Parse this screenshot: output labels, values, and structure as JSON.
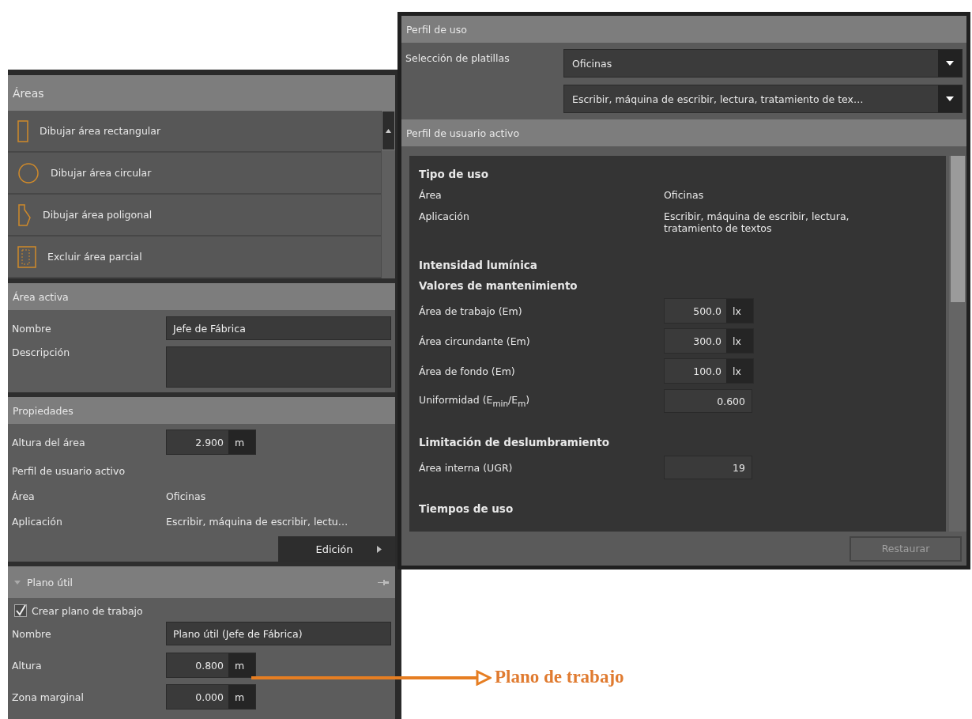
{
  "areas_panel": {
    "title": "Áreas",
    "tools": [
      {
        "kind": "rectangle",
        "label": "Dibujar área rectangular"
      },
      {
        "kind": "circle",
        "label": "Dibujar área circular"
      },
      {
        "kind": "polygon",
        "label": "Dibujar área poligonal"
      },
      {
        "kind": "exclude",
        "label": "Excluir área parcial"
      }
    ],
    "active_area": {
      "title": "Área activa",
      "fields": [
        {
          "kind": "text",
          "label": "Nombre",
          "value": "Jefe de Fábrica"
        },
        {
          "kind": "textarea",
          "label": "Descripción"
        }
      ]
    },
    "properties": {
      "title": "Propiedades",
      "height": {
        "label": "Altura del área",
        "value": "2.900",
        "unit": "m"
      },
      "profile_title": "Perfil de usuario activo",
      "rows": [
        {
          "label": "Área",
          "value": "Oficinas"
        },
        {
          "label": "Aplicación",
          "value": "Escribir, máquina de escribir, lectu…"
        }
      ],
      "edit_button": "Edición"
    },
    "work_plane": {
      "title": "Plano útil",
      "expanded": true,
      "create": {
        "label": "Crear plano de trabajo",
        "checked": true
      },
      "fields": [
        {
          "kind": "text",
          "label": "Nombre",
          "value": "Plano útil (Jefe de Fábrica)"
        },
        {
          "kind": "unit",
          "label": "Altura",
          "value": "0.800",
          "unit": "m"
        },
        {
          "kind": "unit",
          "label": "Zona marginal",
          "value": "0.000",
          "unit": "m"
        }
      ]
    }
  },
  "usage_panel": {
    "title": "Perfil de uso",
    "template_label": "Selección de platillas",
    "dropdowns": [
      "Oficinas",
      "Escribir, máquina de escribir, lectura, tratamiento de tex…"
    ],
    "profile_title": "Perfil de usuario activo",
    "items": [
      {
        "kind": "heading",
        "text": "Tipo de uso"
      },
      {
        "kind": "pair",
        "label": "Área",
        "value": "Oficinas"
      },
      {
        "kind": "pair",
        "label": "Aplicación",
        "value": "Escribir, máquina de escribir, lectura, tratamiento de textos"
      },
      {
        "kind": "heading",
        "text": "Intensidad lumínica"
      },
      {
        "kind": "heading",
        "text": "Valores de mantenimiento"
      },
      {
        "kind": "measure",
        "label": "Área de trabajo (Em)",
        "value": "500.0",
        "unit": "lx"
      },
      {
        "kind": "measure",
        "label": "Área circundante (Em)",
        "value": "300.0",
        "unit": "lx"
      },
      {
        "kind": "measure",
        "label": "Área de fondo (Em)",
        "value": "100.0",
        "unit": "lx"
      },
      {
        "kind": "number",
        "label": "Uniformidad (E$_{min}$/E$_{m}$)",
        "value": "0.600"
      },
      {
        "kind": "heading",
        "text": "Limitación de deslumbramiento"
      },
      {
        "kind": "number",
        "label": "Área interna (UGR)",
        "value": "19"
      },
      {
        "kind": "heading",
        "text": "Tiempos de uso"
      }
    ],
    "restore_button": {
      "label": "Restaurar",
      "disabled": true
    }
  },
  "annotation": {
    "label": "Plano de trabajo"
  }
}
